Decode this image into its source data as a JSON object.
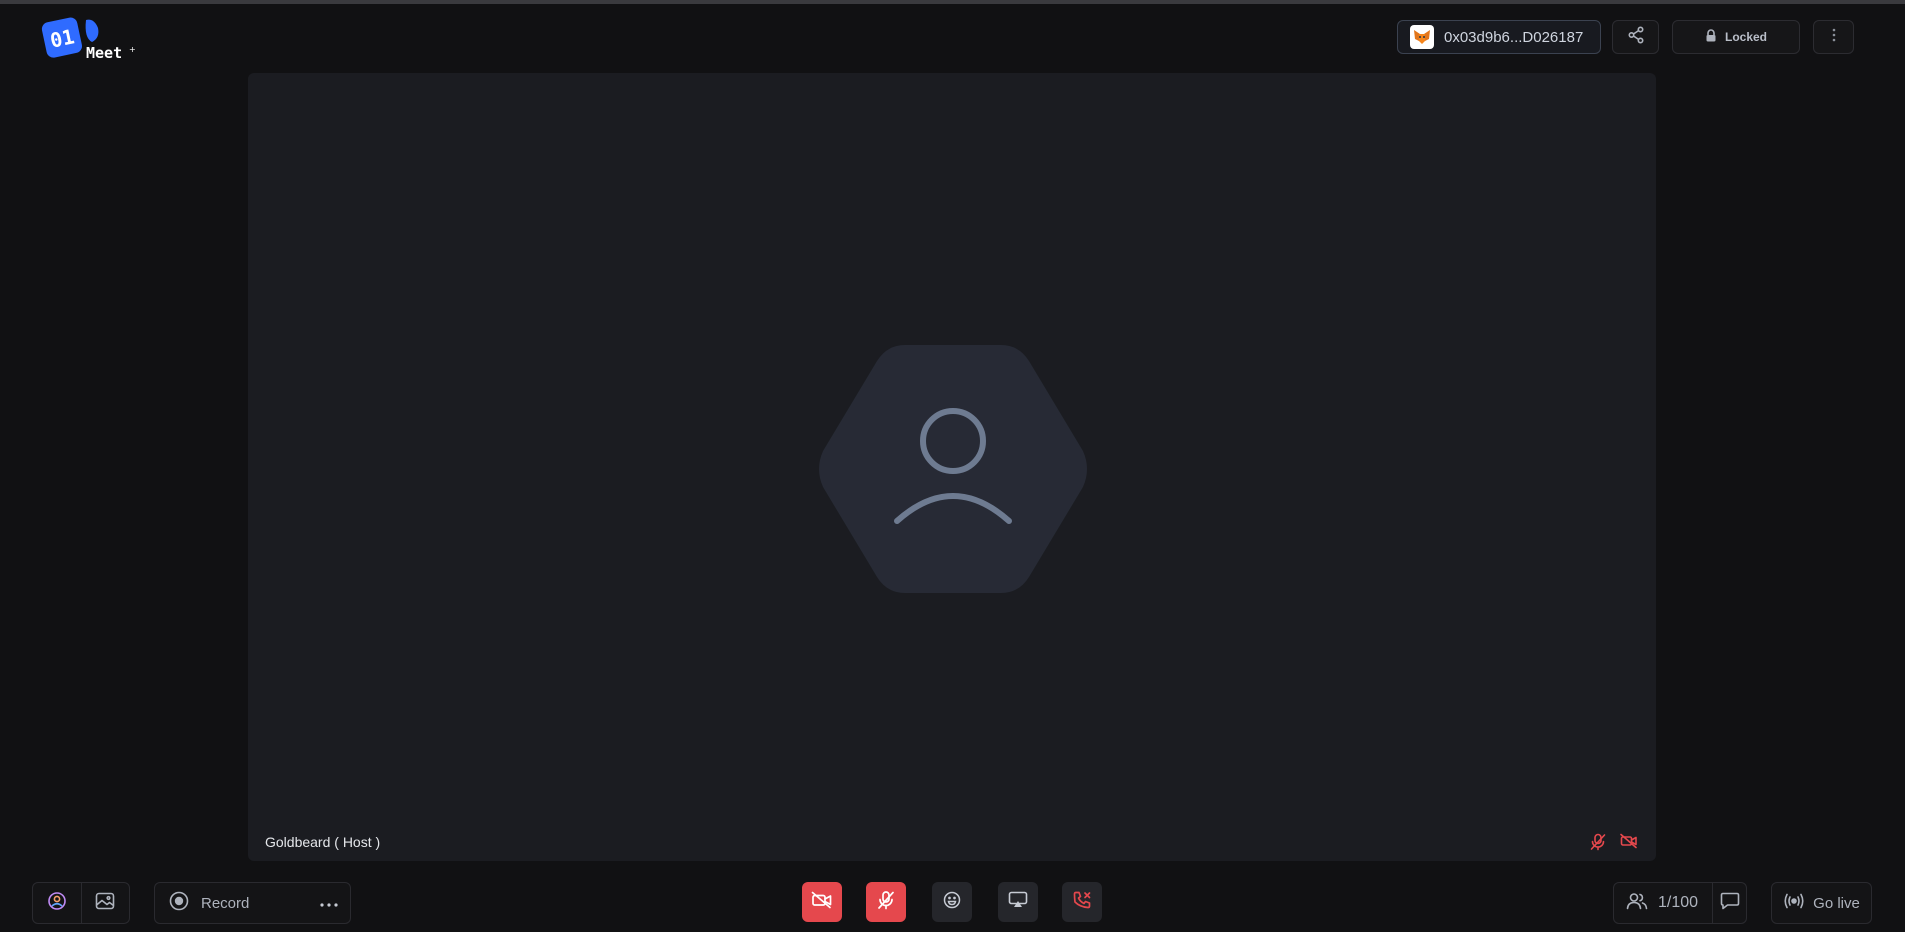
{
  "app": {
    "logo_text": "01 Meet"
  },
  "header": {
    "wallet_address": "0x03d9b6...D026187",
    "wallet_icon": "metamask-fox-icon",
    "lock_label": "Locked"
  },
  "stage": {
    "peer_name": "Goldbeard ( Host )",
    "mic_muted": true,
    "camera_off": true
  },
  "bottom_bar": {
    "record_label": "Record",
    "participants_count": "1/100",
    "go_live_label": "Go live"
  },
  "colors": {
    "danger": "#e5484d",
    "background": "#111113",
    "stage": "#1b1c21",
    "avatar": "#272a35",
    "avatar_icon": "#6e7b91",
    "brand": "#2f6bff"
  }
}
